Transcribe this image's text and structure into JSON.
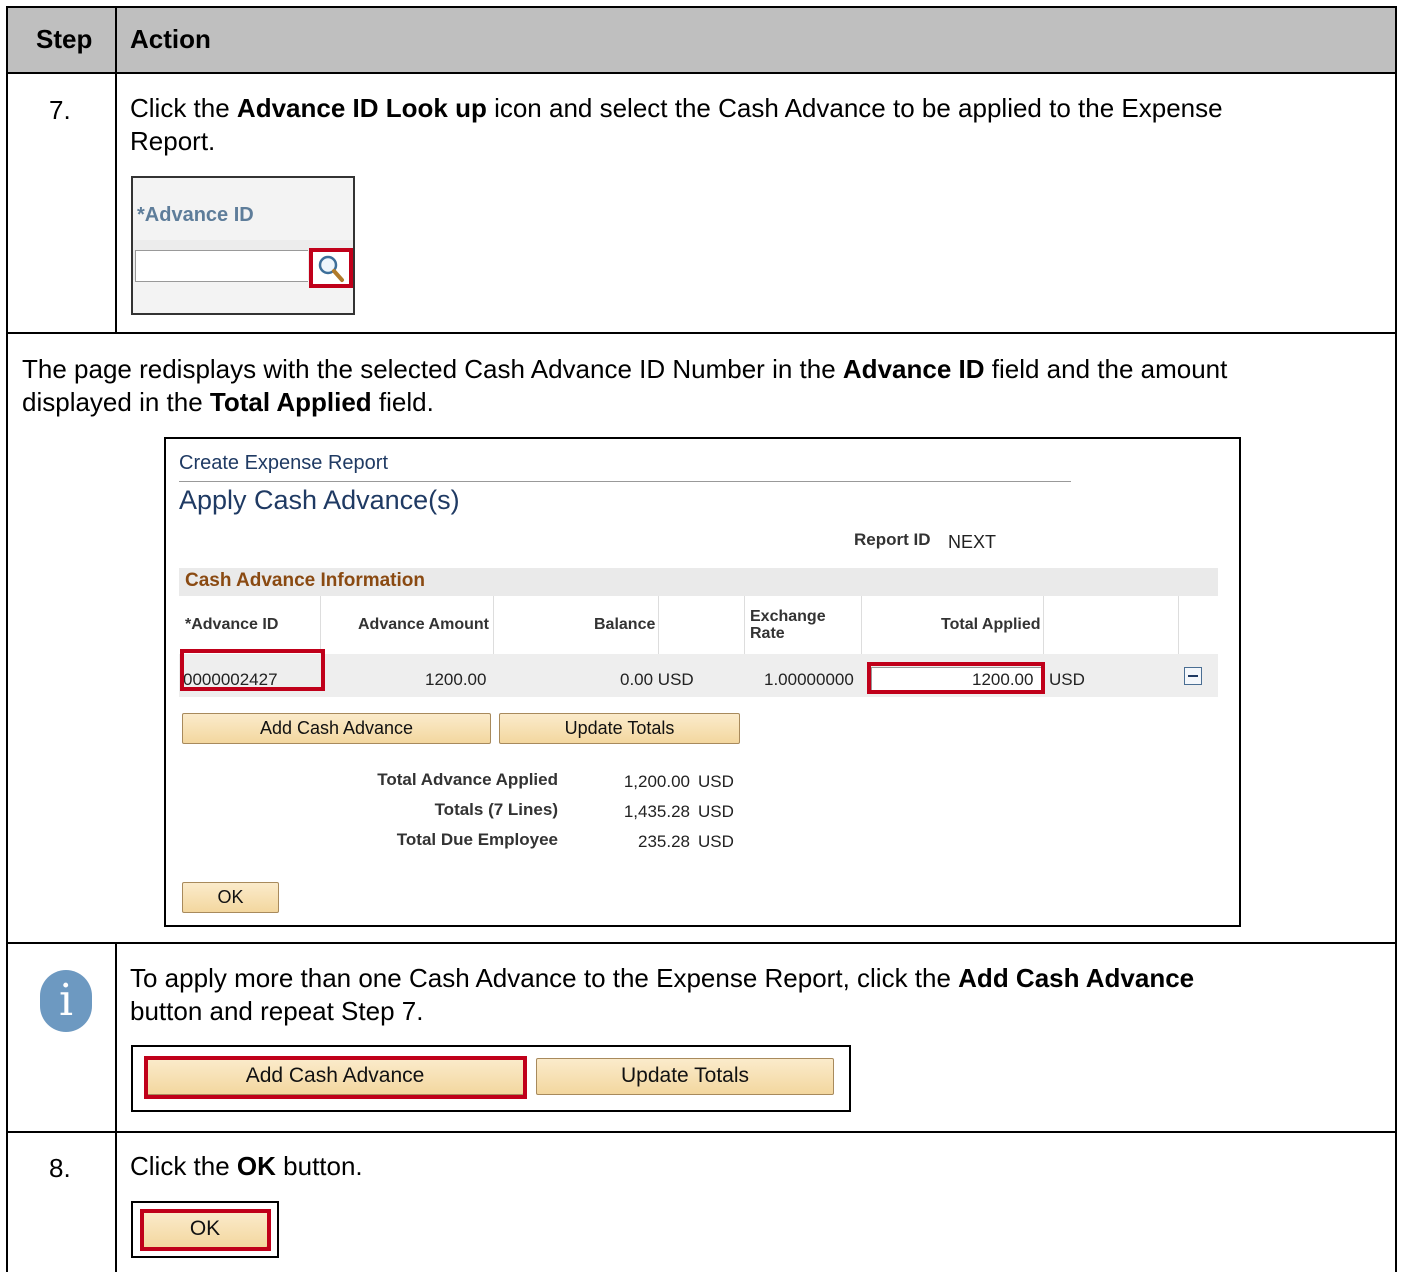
{
  "table": {
    "header_step": "Step",
    "header_action": "Action"
  },
  "row7": {
    "step": "7.",
    "text_pre": "Click the ",
    "text_bold": "Advance ID Look up",
    "text_post_line1": " icon and select the Cash Advance to be applied to the Expense",
    "text_line2": "Report.",
    "mini_label": "*Advance ID",
    "lookup_icon": "search-icon"
  },
  "redisplay": {
    "line1_pre": "The page redisplays with the selected Cash Advance ID Number in the ",
    "line1_bold": "Advance ID",
    "line1_post": " field and the amount",
    "line2_pre": "displayed in the ",
    "line2_bold": "Total Applied",
    "line2_post": " field."
  },
  "panel": {
    "breadcrumb": "Create Expense Report",
    "title": "Apply Cash Advance(s)",
    "report_id_label": "Report ID",
    "report_id_value": "NEXT",
    "section_title": "Cash Advance Information",
    "columns": {
      "advance_id": "*Advance ID",
      "advance_amount": "Advance Amount",
      "balance": "Balance",
      "exchange_rate_1": "Exchange",
      "exchange_rate_2": "Rate",
      "total_applied": "Total Applied"
    },
    "row": {
      "advance_id": "0000002427",
      "advance_amount": "1200.00",
      "balance": "0.00 USD",
      "exchange_rate": "1.00000000",
      "total_applied": "1200.00",
      "currency": "USD"
    },
    "add_button": "Add Cash Advance",
    "update_button": "Update Totals",
    "totals": [
      {
        "label": "Total Advance Applied",
        "value": "1,200.00",
        "currency": "USD"
      },
      {
        "label": "Totals (7 Lines)",
        "value": "1,435.28",
        "currency": "USD"
      },
      {
        "label": "Total Due Employee",
        "value": "235.28",
        "currency": "USD"
      }
    ],
    "ok_button": "OK"
  },
  "note": {
    "icon": "info-icon",
    "icon_glyph": "i",
    "line1_pre": "To apply more than one Cash Advance to the Expense Report, click the ",
    "line1_bold": "Add Cash Advance",
    "line2": "button and repeat Step 7.",
    "add_button": "Add Cash Advance",
    "update_button": "Update Totals"
  },
  "row8": {
    "step": "8.",
    "text_pre": "Click the ",
    "text_bold": "OK",
    "text_post": " button.",
    "ok_button": "OK"
  }
}
